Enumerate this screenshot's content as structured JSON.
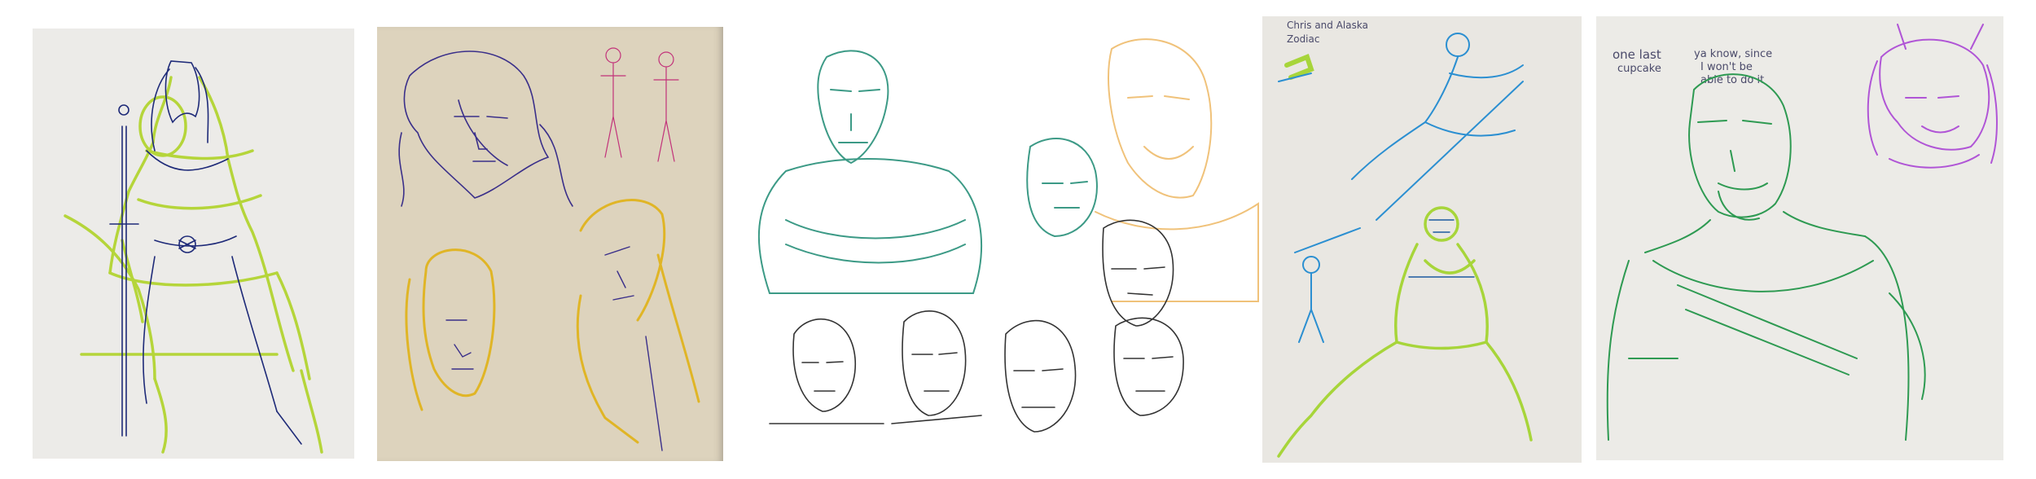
{
  "panels": [
    {
      "subject": "warrior-with-sword",
      "pen_colors": [
        "#b5d53a",
        "#1e2a78"
      ]
    },
    {
      "subject": "sketchbook-heads-and-figures",
      "pen_colors": [
        "#e0b526",
        "#3a2f8a",
        "#c2327a"
      ]
    },
    {
      "subject": "digital-head-studies",
      "pen_colors": [
        "#3c9a86",
        "#f0c27a",
        "#333333"
      ]
    },
    {
      "subject": "action-poses",
      "pen_colors": [
        "#2b8fd1",
        "#a7d53a"
      ]
    },
    {
      "subject": "bearded-man-and-girl",
      "pen_colors": [
        "#2e9a52",
        "#b055d6"
      ]
    }
  ],
  "notes": {
    "p4_top": "Chris and Alaska",
    "p4_sub": "Zodiac",
    "p5_left1": "one last",
    "p5_left2": "cupcake",
    "p5_mid1": "ya know, since",
    "p5_mid2": "I won't be",
    "p5_mid3": "able to do it"
  }
}
